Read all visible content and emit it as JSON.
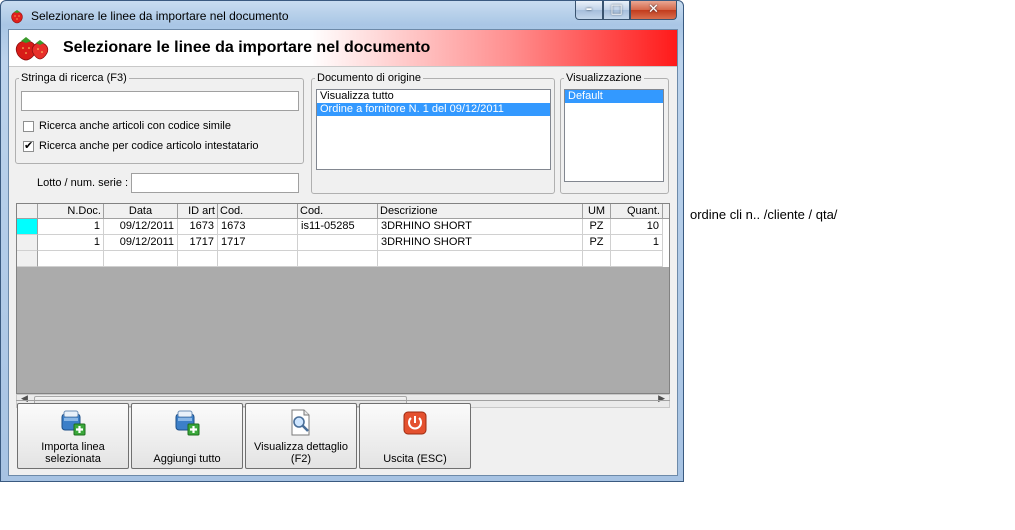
{
  "window": {
    "title": "Selezionare le linee da importare nel documento",
    "minimize_glyph": "–",
    "maximize_glyph": "□",
    "close_glyph": "✕"
  },
  "header": {
    "title": "Selezionare le linee da importare nel documento",
    "icon": "strawberry-icon",
    "gradient_color": "#ff1a1a"
  },
  "search": {
    "group_label": "Stringa di ricerca (F3)",
    "value": "",
    "checkbox_similar_label": "Ricerca anche articoli con codice simile",
    "checkbox_similar_checked": false,
    "checkbox_holder_label": "Ricerca anche per codice articolo intestatario",
    "checkbox_holder_checked": true,
    "lot_label": "Lotto / num. serie :",
    "lot_value": ""
  },
  "origin": {
    "group_label": "Documento di origine",
    "items": [
      "Visualizza tutto",
      "Ordine a fornitore N. 1 del 09/12/2011"
    ],
    "selected_index": 1
  },
  "view": {
    "group_label": "Visualizzazione",
    "items": [
      "Default"
    ],
    "selected_index": 0
  },
  "grid": {
    "columns": [
      "N.Doc.",
      "Data",
      "ID art",
      "Cod.",
      "Cod.",
      "Descrizione",
      "UM",
      "Quant."
    ],
    "rows": [
      [
        "1",
        "09/12/2011",
        "1673",
        "1673",
        "is11-05285",
        "3DRHINO SHORT",
        "PZ",
        "10"
      ],
      [
        "1",
        "09/12/2011",
        "1717",
        "1717",
        "",
        "3DRHINO SHORT",
        "PZ",
        "1"
      ]
    ],
    "current_row_color": "#00ffff"
  },
  "buttons": {
    "import_selected": "Importa linea selezionata",
    "add_all": "Aggiungi tutto",
    "view_detail": "Visualizza dettaglio (F2)",
    "exit": "Uscita (ESC)"
  },
  "annotation": "ordine cli n..  /cliente / qta/"
}
